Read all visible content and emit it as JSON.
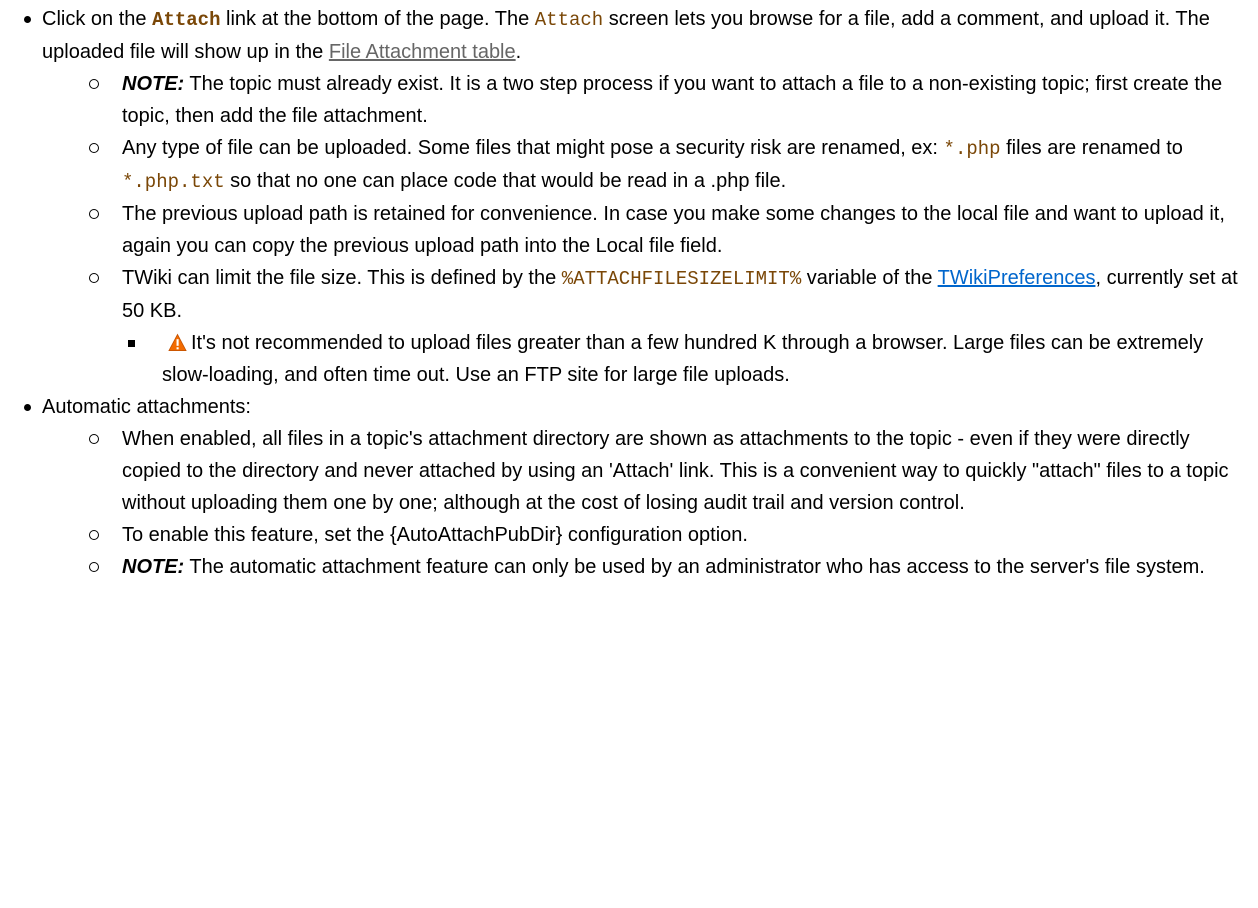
{
  "item_attach": {
    "t1": "Click on the ",
    "attach_bold": "Attach",
    "t2": " link at the bottom of the page. The ",
    "attach_code": "Attach",
    "t3": " screen lets you browse for a file, add a comment, and upload it. The uploaded file will show up in the ",
    "file_table_link": "File Attachment table",
    "t4": ".",
    "sub": {
      "note1_label": "NOTE:",
      "note1_text": " The topic must already exist. It is a two step process if you want to attach a file to a non-existing topic; first create the topic, then add the file attachment.",
      "any_type_t1": "Any type of file can be uploaded. Some files that might pose a security risk are renamed, ex: ",
      "php_code": "*.php",
      "any_type_t2": " files are renamed to ",
      "php_txt_code": "*.php.txt",
      "any_type_t3": " so that no one can place code that would be read in a .php file.",
      "prev_path_text": "The previous upload path is retained for convenience. In case you make some changes to the local file and want to upload it, again you can copy the previous upload path into the Local file field.",
      "limit_t1": "TWiki can limit the file size. This is defined by the ",
      "limit_var": "%ATTACHFILESIZELIMIT%",
      "limit_t2": " variable of the ",
      "prefs_link": "TWikiPreferences",
      "limit_t3": ", currently set at 50 KB.",
      "warn_text": "It's not recommended to upload files greater than a few hundred K through a browser. Large files can be extremely slow-loading, and often time out. Use an FTP site for large file uploads."
    }
  },
  "item_auto": {
    "label": "Automatic attachments:",
    "sub": {
      "enabled_text": "When enabled, all files in a topic's attachment directory are shown as attachments to the topic - even if they were directly copied to the directory and never attached by using an 'Attach' link. This is a convenient way to quickly \"attach\" files to a topic without uploading them one by one; although at the cost of losing audit trail and version control.",
      "enable_text": "To enable this feature, set the {AutoAttachPubDir} configuration option.",
      "note2_label": "NOTE:",
      "note2_text": " The automatic attachment feature can only be used by an administrator who has access to the server's file system."
    }
  },
  "icons": {
    "warning": "warning-triangle-icon"
  },
  "colors": {
    "code": "#7a4707",
    "link_gray": "#666666",
    "link_blue": "#0066cc",
    "warning_orange": "#f26b00"
  }
}
